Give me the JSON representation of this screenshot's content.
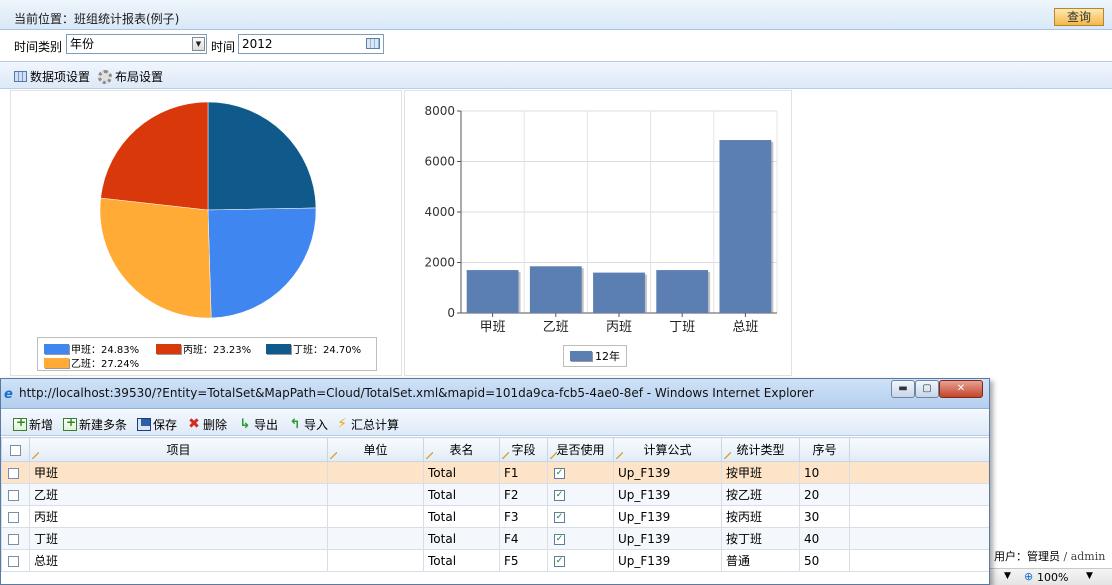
{
  "header": {
    "location": "当前位置：班组统计报表(例子)",
    "query_button": "查询"
  },
  "filter": {
    "time_type_label": "时间类别",
    "time_type_value": "年份",
    "time_label": "时间",
    "time_value": "2012"
  },
  "toolbar": {
    "data_settings": "数据项设置",
    "layout_settings": "布局设置"
  },
  "pie_chart": {
    "legend": [
      {
        "label": "甲班：24.83%",
        "color": "#3f86f0"
      },
      {
        "label": "丙班：23.23%",
        "color": "#d9390a"
      },
      {
        "label": "丁班：24.70%",
        "color": "#0f5a8a"
      },
      {
        "label": "乙班：27.24%",
        "color": "#ffab36"
      }
    ]
  },
  "chart_data": [
    {
      "type": "pie",
      "categories": [
        "甲班",
        "乙班",
        "丙班",
        "丁班"
      ],
      "values": [
        24.83,
        27.24,
        23.23,
        24.7
      ],
      "colors": [
        "#3f86f0",
        "#ffab36",
        "#d9390a",
        "#0f5a8a"
      ],
      "unit": "%",
      "legend_position": "bottom"
    },
    {
      "type": "bar",
      "categories": [
        "甲班",
        "乙班",
        "丙班",
        "丁班",
        "总班"
      ],
      "series": [
        {
          "name": "12年",
          "values": [
            1700,
            1850,
            1600,
            1700,
            6850
          ],
          "color": "#5b7fb2"
        }
      ],
      "y_ticks": [
        0,
        2000,
        4000,
        6000,
        8000
      ],
      "ylim": [
        0,
        8000
      ],
      "grid": true,
      "legend_position": "bottom"
    }
  ],
  "popup": {
    "title": "http://localhost:39530/?Entity=TotalSet&MapPath=Cloud/TotalSet.xml&mapid=101da9ca-fcb5-4ae0-8ef - Windows Internet Explorer",
    "toolbar": [
      "新增",
      "新建多条",
      "保存",
      "删除",
      "导出",
      "导入",
      "汇总计算"
    ],
    "columns": [
      "项目",
      "单位",
      "表名",
      "字段",
      "是否使用",
      "计算公式",
      "统计类型",
      "序号"
    ],
    "rows": [
      {
        "item": "甲班",
        "unit": "",
        "table": "Total",
        "field": "F1",
        "used": true,
        "formula": "Up_F139",
        "stat": "按甲班",
        "order": "10"
      },
      {
        "item": "乙班",
        "unit": "",
        "table": "Total",
        "field": "F2",
        "used": true,
        "formula": "Up_F139",
        "stat": "按乙班",
        "order": "20"
      },
      {
        "item": "丙班",
        "unit": "",
        "table": "Total",
        "field": "F3",
        "used": true,
        "formula": "Up_F139",
        "stat": "按丙班",
        "order": "30"
      },
      {
        "item": "丁班",
        "unit": "",
        "table": "Total",
        "field": "F4",
        "used": true,
        "formula": "Up_F139",
        "stat": "按丁班",
        "order": "40"
      },
      {
        "item": "总班",
        "unit": "",
        "table": "Total",
        "field": "F5",
        "used": true,
        "formula": "Up_F139",
        "stat": "普通",
        "order": "50"
      }
    ]
  },
  "status": {
    "user": "用户：管理员",
    "account": "/ admin",
    "zoom": "100%"
  }
}
